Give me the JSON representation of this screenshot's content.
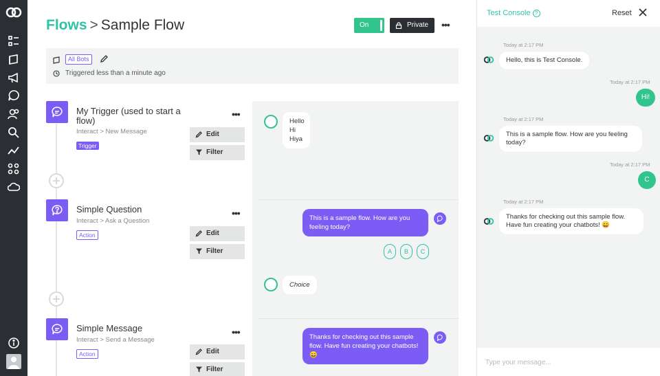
{
  "header": {
    "crumb_link": "Flows",
    "crumb_sep": ">",
    "title": "Sample Flow",
    "toggle_label": "On",
    "private_label": "Private",
    "more": "•••"
  },
  "info": {
    "bots_chip": "All Bots",
    "triggered": "Triggered less than a minute ago"
  },
  "steps": [
    {
      "title": "My Trigger (used to start a flow)",
      "sub_app": "Interact",
      "sub_sep": ">",
      "sub_event": "New Message",
      "badge": "Trigger",
      "edit": "Edit",
      "filter": "Filter"
    },
    {
      "title": "Simple Question",
      "sub_app": "Interact",
      "sub_sep": ">",
      "sub_event": "Ask a Question",
      "badge": "Action",
      "edit": "Edit",
      "filter": "Filter"
    },
    {
      "title": "Simple Message",
      "sub_app": "Interact",
      "sub_sep": ">",
      "sub_event": "Send a Message",
      "badge": "Action",
      "edit": "Edit",
      "filter": "Filter"
    }
  ],
  "preview": {
    "trigger_lines": [
      "Hello",
      "Hi",
      "Hiya"
    ],
    "question": "This is a sample flow. How are you feeling today?",
    "choices": [
      "A",
      "B",
      "C"
    ],
    "choice_label": "Choice",
    "message": "Thanks for checking out this sample flow. Have fun creating your chatbots! 😄"
  },
  "console": {
    "title": "Test Console",
    "help": "?",
    "reset": "Reset",
    "messages": [
      {
        "time": "Today at 2:17 PM",
        "from": "bot",
        "text": "Hello, this is Test Console."
      },
      {
        "time": "Today at 2:17 PM",
        "from": "user",
        "text": "Hi!"
      },
      {
        "time": "Today at 2:17 PM",
        "from": "bot",
        "text": "This is a sample flow. How are you feeling today?"
      },
      {
        "time": "Today at 2:17 PM",
        "from": "user",
        "text": "C"
      },
      {
        "time": "Today at 2:17 PM",
        "from": "bot",
        "text": "Thanks for checking out this sample flow. Have fun creating your chatbots! 😄"
      }
    ],
    "input_placeholder": "Type your message..."
  },
  "colors": {
    "accent": "#2fc3a8",
    "purple": "#7b5cf5",
    "green": "#31c48d",
    "nav": "#2b2f33"
  }
}
